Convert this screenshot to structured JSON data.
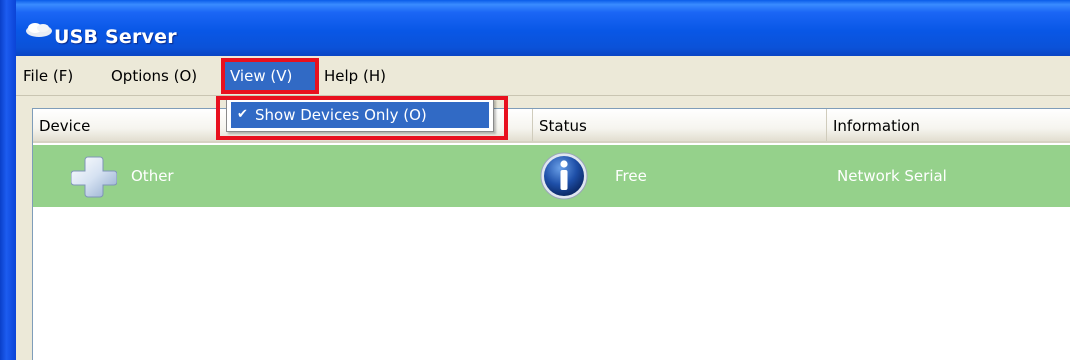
{
  "window": {
    "title": "USB Server",
    "title_icon": "usb-server-cloud-icon",
    "colors": {
      "titlebar": "#0957e6",
      "selection": "#316ac5",
      "row_bg": "#95d18b",
      "highlight_frame": "#e8101e"
    }
  },
  "menubar": {
    "items": [
      {
        "label": "File (F)"
      },
      {
        "label": "Options (O)"
      },
      {
        "label": "View (V)",
        "state": "open"
      },
      {
        "label": "Help (H)"
      }
    ]
  },
  "view_menu": {
    "items": [
      {
        "label": "Show Devices Only (O)",
        "checked": true,
        "check_icon": "checkmark-icon"
      }
    ]
  },
  "device_list": {
    "columns": [
      "Device",
      "Status",
      "Information"
    ],
    "rows": [
      {
        "device": "Other",
        "device_icon": "plus-device-icon",
        "status": "Free",
        "status_icon": "info-icon",
        "information": "Network Serial"
      }
    ]
  }
}
